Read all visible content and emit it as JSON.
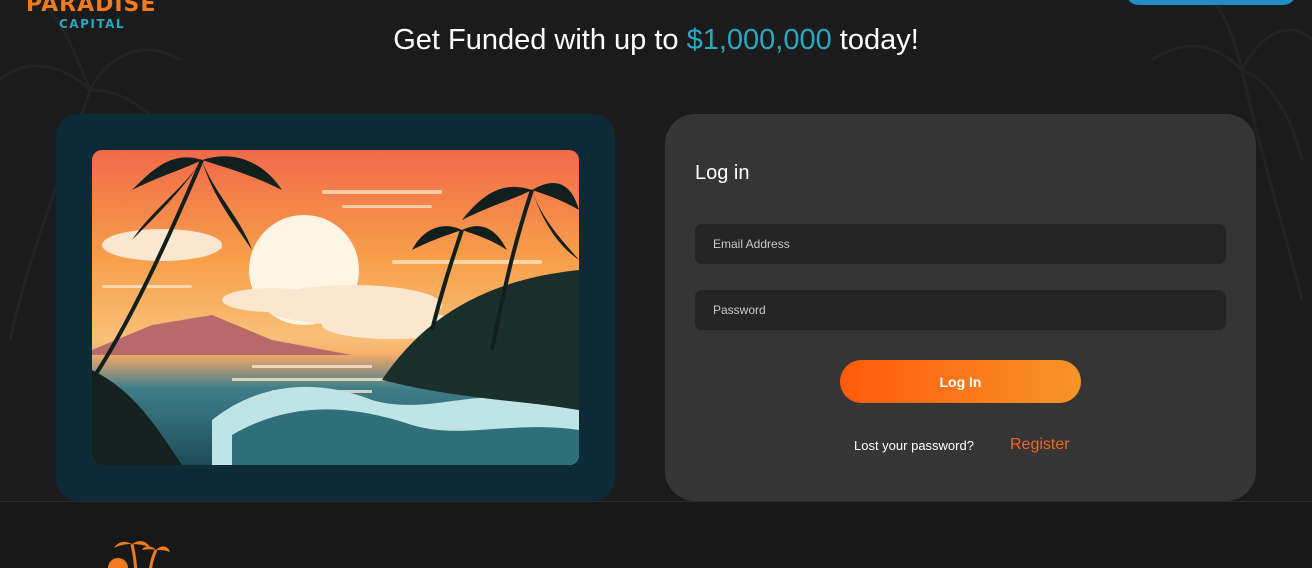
{
  "brand": {
    "name_top": "PARADISE",
    "name_bottom": "CAPITAL",
    "logo_icon": "palm-sunset-icon"
  },
  "headline": {
    "prefix": "Get Funded with up to ",
    "amount": "$1,000,000",
    "suffix": " today!"
  },
  "hero_image": {
    "subject": "tropical sunset beach illustration"
  },
  "login": {
    "title": "Log in",
    "email_placeholder": "Email Address",
    "password_placeholder": "Password",
    "submit_label": "Log In",
    "lost_password_label": "Lost your password?",
    "register_label": "Register"
  },
  "colors": {
    "background": "#1b1b1c",
    "accent_orange": "#f07a20",
    "accent_teal": "#2aa7c2",
    "card": "#353535",
    "image_frame": "#0c2b37"
  }
}
